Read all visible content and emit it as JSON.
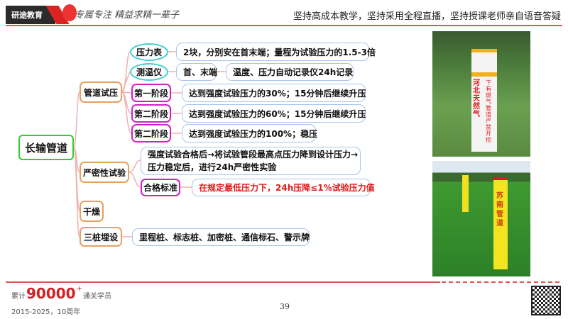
{
  "header": {
    "logo_text": "研途教育",
    "slogan": "专属专注 精益求精一辈子",
    "tagline": "坚持高成本教学，坚持采用全程直播，坚持授课老师亲自语音答疑"
  },
  "mindmap": {
    "root": "长输管道",
    "branches": [
      {
        "label": "管道试压",
        "children": [
          {
            "label": "压力表",
            "details": [
              "2块，分别安在首末端；量程为试验压力的1.5-3倍"
            ]
          },
          {
            "label": "测温仪",
            "details": [
              "首、末端",
              "温度、压力自动记录仪24h记录"
            ]
          },
          {
            "label": "第一阶段",
            "details": [
              "达到强度试验压力的30%；15分钟后继续升压"
            ]
          },
          {
            "label": "第二阶段",
            "details": [
              "达到强度试验压力的60%；15分钟后继续升压"
            ]
          },
          {
            "label": "第二阶段",
            "details": [
              "达到强度试验压力的100%；稳压"
            ]
          }
        ]
      },
      {
        "label": "严密性试验",
        "children": [
          {
            "label": "",
            "details": [
              "强度试验合格后→将试验管段最高点压力降到设计压力→",
              "压力稳定后，进行24h严密性实验"
            ]
          },
          {
            "label": "合格标准",
            "details": [
              "在规定最低压力下，24h压降≤1%试验压力值"
            ]
          }
        ]
      },
      {
        "label": "干燥"
      },
      {
        "label": "三桩埋设",
        "children": [
          {
            "details": [
              "里程桩、标志桩、加密桩、通信标石、警示牌"
            ]
          }
        ]
      }
    ]
  },
  "photos": {
    "top_marker": {
      "left": "河北天然气",
      "right": "下有燃气管道 严禁开挖"
    },
    "bottom_marker": "苏南管道"
  },
  "footer": {
    "prefix": "累计",
    "count": "90000",
    "plus": "+",
    "suffix": "通关学员",
    "years": "2015-2025，10周年",
    "page": "39"
  },
  "colors": {
    "accent": "#d55555",
    "highlight": "#e01818"
  }
}
